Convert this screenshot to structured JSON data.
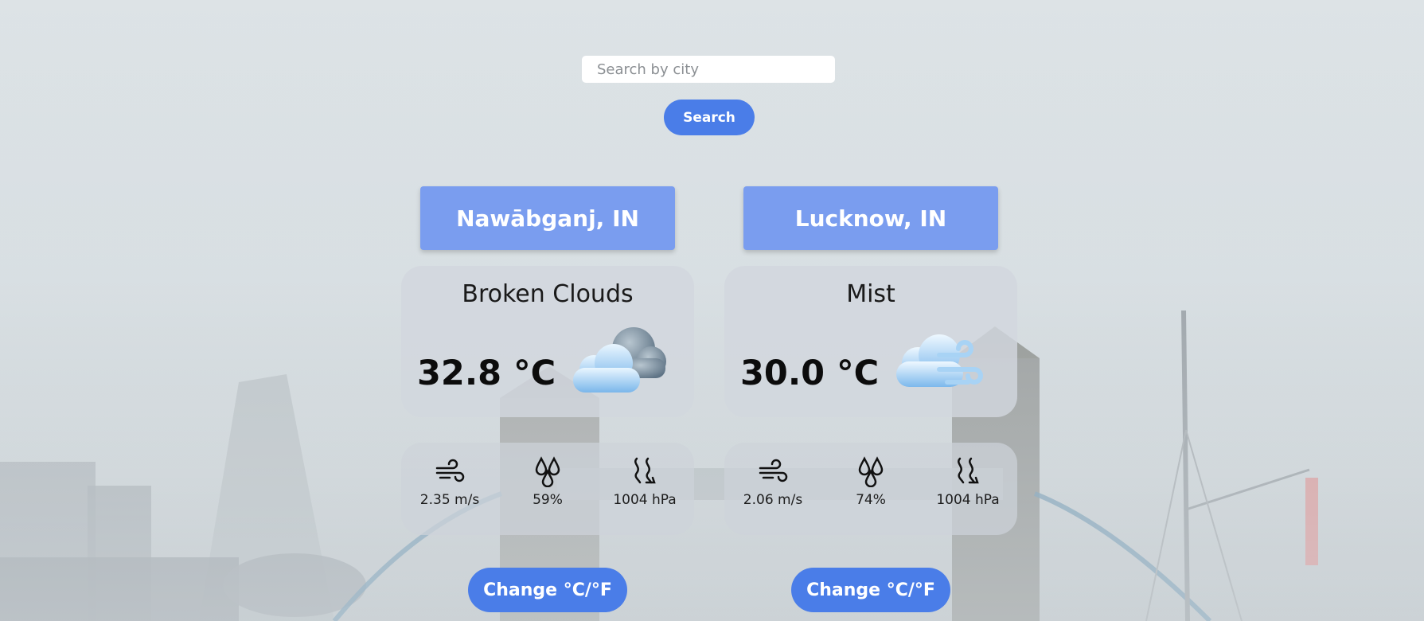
{
  "search": {
    "placeholder": "Search by city",
    "button_label": "Search"
  },
  "cards": [
    {
      "city": "Nawābganj, IN",
      "condition": "Broken Clouds",
      "temperature": "32.8 °C",
      "icon": "broken-clouds-icon",
      "wind": "2.35 m/s",
      "humidity": "59%",
      "pressure": "1004 hPa",
      "toggle_label": "Change °C/°F"
    },
    {
      "city": "Lucknow, IN",
      "condition": "Mist",
      "temperature": "30.0 °C",
      "icon": "mist-icon",
      "wind": "2.06 m/s",
      "humidity": "74%",
      "pressure": "1004 hPa",
      "toggle_label": "Change °C/°F"
    }
  ],
  "colors": {
    "accent": "#4a7de8",
    "header": "#7a9def",
    "panel": "#d2d7de"
  }
}
